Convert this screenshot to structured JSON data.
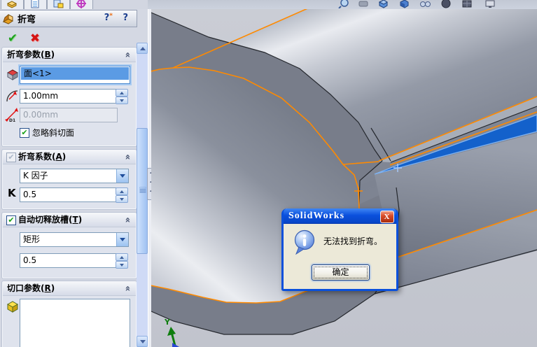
{
  "toolbar": {
    "icons": [
      {
        "name": "zoom-icon"
      },
      {
        "name": "previous-view-icon"
      },
      {
        "name": "view-orientation-icon"
      },
      {
        "name": "standard-views-icon"
      },
      {
        "name": "display-style-icon"
      },
      {
        "name": "shadows-icon"
      },
      {
        "name": "scene-icon"
      },
      {
        "name": "view-settings-icon"
      }
    ]
  },
  "propertyManager": {
    "tabs": [
      {
        "name": "featuremanager-tab"
      },
      {
        "name": "propertymanager-tab"
      },
      {
        "name": "configurationmanager-tab"
      },
      {
        "name": "dimxpert-tab"
      }
    ],
    "title": "折弯",
    "help_quick_mark": "?",
    "help_star": "*",
    "help_mark": "?",
    "ok_glyph": "✔",
    "cancel_glyph": "✖",
    "collapse_glyph": "«",
    "splitter_glyph": "◂◂◂",
    "groups": {
      "bendParams": {
        "label": "折弯参数",
        "mnemonic": "B",
        "face_selection": "面<1>",
        "radius_value": "1.00mm",
        "offset_value": "0.00mm",
        "ignore_bevel_label": "忽略斜切面",
        "ignore_bevel_checked": true
      },
      "bendAllowance": {
        "label": "折弯系数",
        "mnemonic": "A",
        "enabled_checked": true,
        "type_value": "K 因子",
        "k_label": "K",
        "k_value": "0.5"
      },
      "autoRelief": {
        "label": "自动切释放槽",
        "mnemonic": "T",
        "enabled_checked": true,
        "type_value": "矩形",
        "ratio_value": "0.5"
      },
      "ripParams": {
        "label": "切口参数",
        "mnemonic": "R",
        "edge_list": ""
      }
    }
  },
  "dialog": {
    "title": "SolidWorks",
    "close_glyph": "X",
    "message": "无法找到折弯。",
    "ok_label": "确定"
  },
  "viewport": {
    "triad_y_label": "Y"
  },
  "colors": {
    "selection_edge_orange": "#ff8a00",
    "selected_face_blue": "#1361cb",
    "dialog_title_blue": "#0a50dc",
    "panel_bg": "#d4d8e3",
    "model_gray": "#8a909d"
  }
}
